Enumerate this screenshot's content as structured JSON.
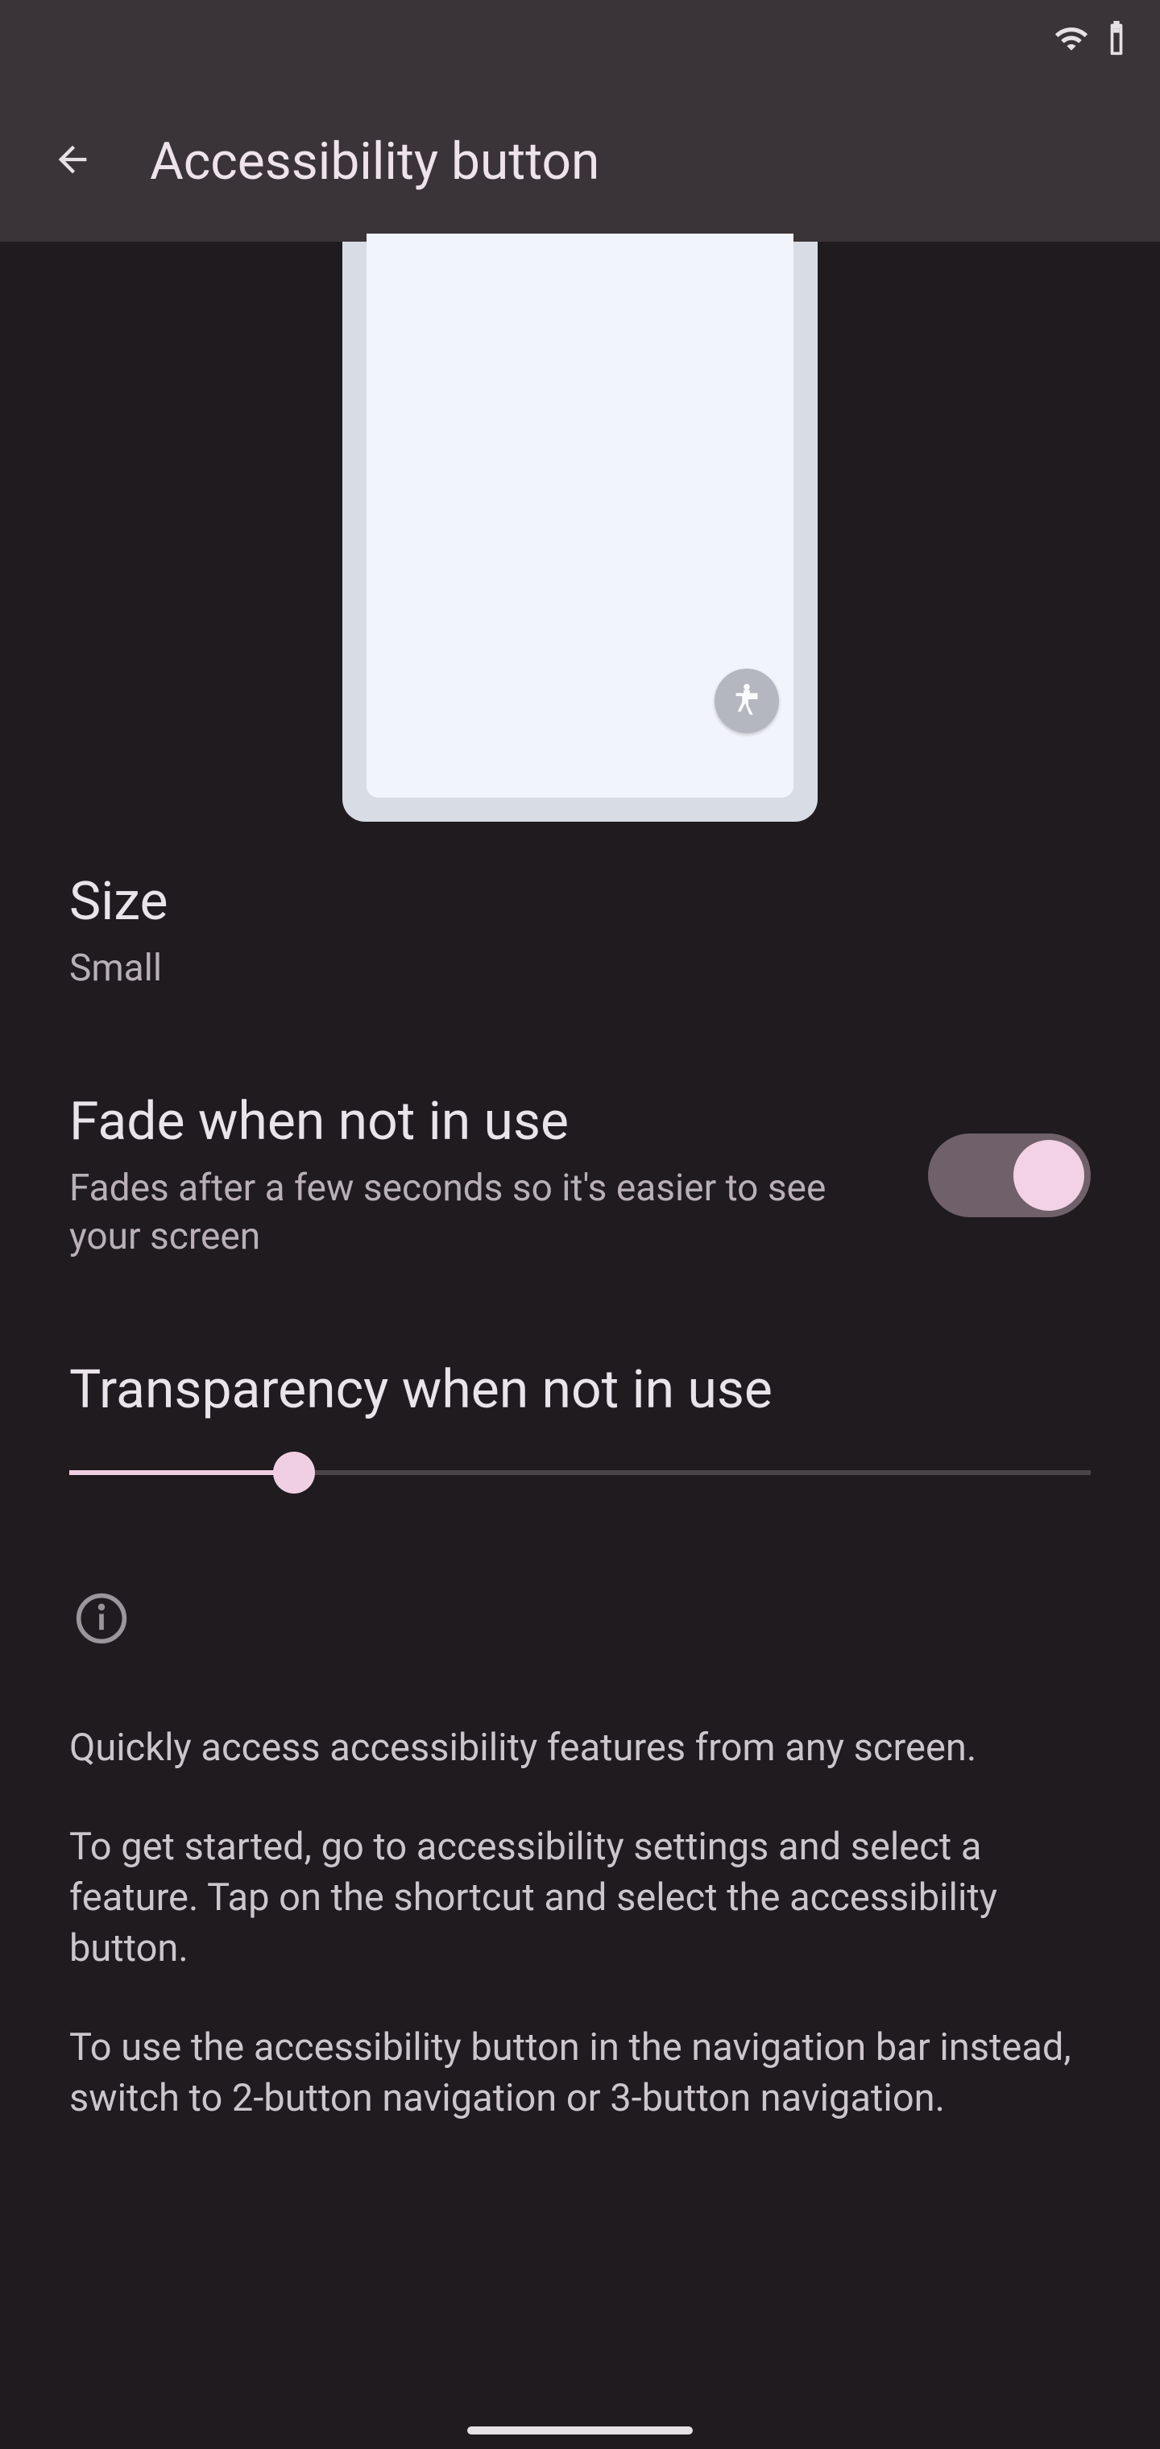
{
  "header": {
    "title": "Accessibility button"
  },
  "preview": {
    "icon_name": "accessibility-icon"
  },
  "size": {
    "title": "Size",
    "value": "Small"
  },
  "fade": {
    "title": "Fade when not in use",
    "subtitle": "Fades after a few seconds so it's easier to see your screen",
    "enabled": true
  },
  "transparency": {
    "title": "Transparency when not in use",
    "value_percent": 22
  },
  "info": {
    "p1": "Quickly access accessibility features from any screen.",
    "p2": "To get started, go to accessibility settings and select a feature. Tap on the shortcut and select the accessibility button.",
    "p3": "To use the accessibility button in the navigation bar instead, switch to 2-button navigation or 3-button navigation."
  }
}
